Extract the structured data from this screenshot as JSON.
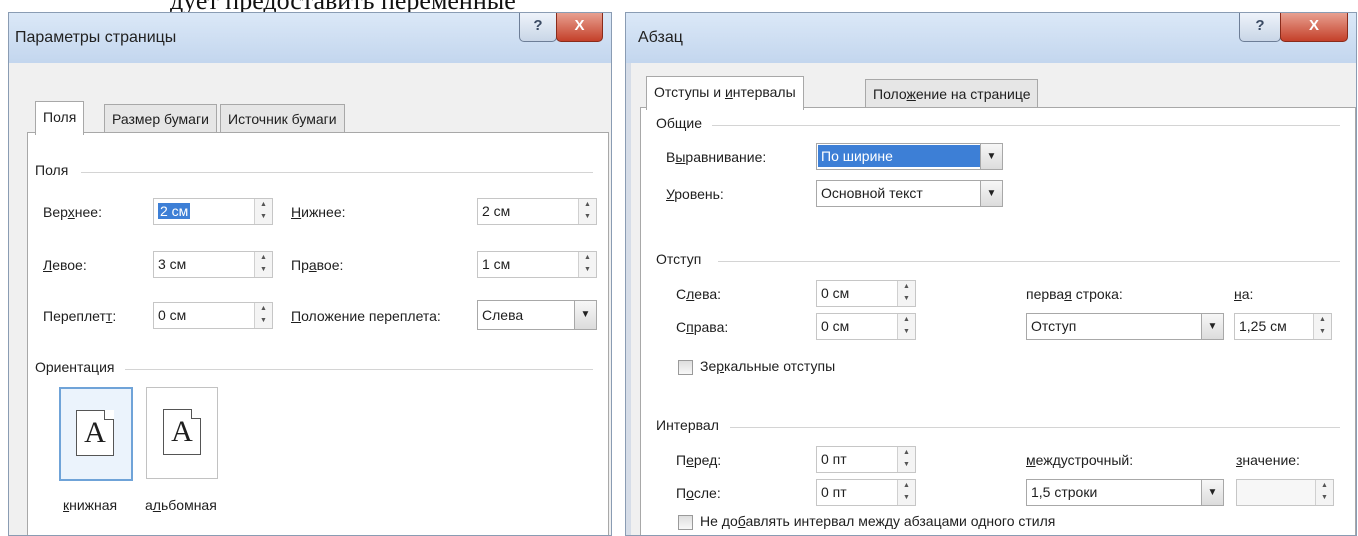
{
  "top_text": "дует предоставить переменные",
  "page_setup": {
    "title": "Параметры страницы",
    "help_label": "?",
    "close_label": "X",
    "tabs": [
      {
        "label": "Поля",
        "active": true
      },
      {
        "label": "Размер бумаги",
        "active": false
      },
      {
        "label": "Источник бумаги",
        "active": false
      }
    ],
    "margins_group": "Поля",
    "top_pre": "Вер",
    "top_u": "х",
    "top_post": "нее:",
    "top_value": "2 см",
    "bottom_u": "Н",
    "bottom_post": "ижнее:",
    "bottom_value": "2 см",
    "left_pre": "",
    "left_u": "Л",
    "left_post": "евое:",
    "left_value": "3 см",
    "right_pre": "Пр",
    "right_u": "а",
    "right_post": "вое:",
    "right_value": "1 см",
    "gutter_pre": "Переплет",
    "gutter_u": "т",
    "gutter_post": ":",
    "gutter_value": "0 см",
    "gutter_pos_u": "П",
    "gutter_pos_post": "оложение переплета:",
    "gutter_pos_value": "Слева",
    "orientation_group": "Ориентация",
    "portrait_u": "к",
    "portrait_post": "нижная",
    "landscape_pre": "а",
    "landscape_u": "л",
    "landscape_post": "ьбомная",
    "page_letter": "A"
  },
  "paragraph": {
    "title": "Абзац",
    "help_label": "?",
    "close_label": "X",
    "tabs": [
      {
        "label_pre": "Отступы и ",
        "label_u": "и",
        "label_post": "нтервалы",
        "active": true
      },
      {
        "label_pre": "Поло",
        "label_u": "ж",
        "label_post": "ение на странице",
        "active": false
      }
    ],
    "general_group": "Общие",
    "alignment_pre": "В",
    "alignment_u": "ы",
    "alignment_post": "равнивание:",
    "alignment_value": "По ширине",
    "level_u": "У",
    "level_post": "ровень:",
    "level_value": "Основной текст",
    "indent_group": "Отступ",
    "left_pre": "С",
    "left_u": "л",
    "left_post": "ева:",
    "left_value": "0 см",
    "right_pre": "С",
    "right_u": "п",
    "right_post": "рава:",
    "right_value": "0 см",
    "first_line_pre": "перва",
    "first_line_u": "я",
    "first_line_post": " строка:",
    "first_line_value": "Отступ",
    "by_u": "н",
    "by_post": "а:",
    "by_value": "1,25 см",
    "mirror_pre": "Зе",
    "mirror_u": "р",
    "mirror_post": "кальные отступы",
    "spacing_group": "Интервал",
    "before_pre": "П",
    "before_u": "е",
    "before_post": "ред:",
    "before_value": "0 пт",
    "after_pre": "П",
    "after_u": "о",
    "after_post": "сле:",
    "after_value": "0 пт",
    "line_spacing_u": "м",
    "line_spacing_post": "еждустрочный:",
    "line_spacing_value": "1,5 строки",
    "at_u": "з",
    "at_post": "начение:",
    "at_value": "",
    "no_space_pre": "Не до",
    "no_space_u": "б",
    "no_space_post": "авлять интервал между абзацами одного стиля"
  }
}
